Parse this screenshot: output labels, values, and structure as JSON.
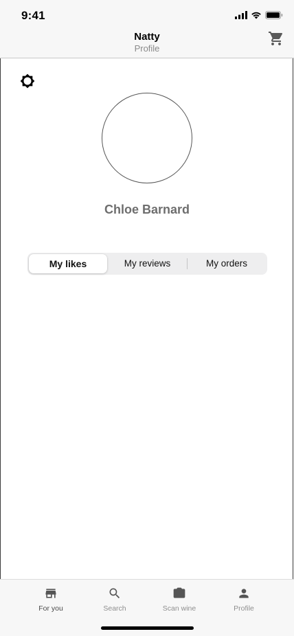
{
  "status_bar": {
    "time": "9:41"
  },
  "nav": {
    "title": "Natty",
    "subtitle": "Profile"
  },
  "profile": {
    "name": "Chloe Barnard"
  },
  "segments": {
    "items": [
      "My likes",
      "My reviews",
      "My orders"
    ],
    "selected": "My likes"
  },
  "tab_bar": {
    "items": [
      {
        "label": "For you",
        "icon": "store-icon"
      },
      {
        "label": "Search",
        "icon": "search-icon"
      },
      {
        "label": "Scan wine",
        "icon": "scan-icon"
      },
      {
        "label": "Profile",
        "icon": "person-icon"
      }
    ],
    "selected": "For you"
  }
}
